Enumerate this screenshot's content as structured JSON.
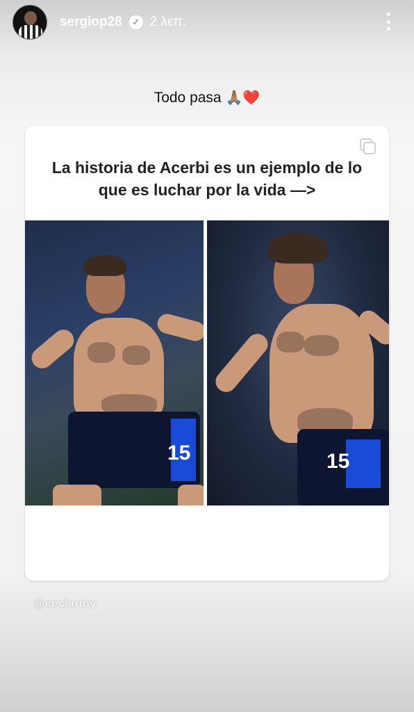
{
  "story": {
    "username": "sergiop28",
    "time_ago": "2 λεπ.",
    "caption_text": "Todo pasa",
    "caption_emojis": "🙏🏽❤️"
  },
  "post": {
    "headline": "La historia de Acerbi es un ejemplo de lo que es luchar por la vida —>",
    "left_jersey_number": "15",
    "right_jersey_number": "15"
  },
  "mention": "@ceciarmy",
  "icons": [
    "avatar",
    "verified-badge-icon",
    "more-options-icon",
    "multi-photo-icon"
  ]
}
